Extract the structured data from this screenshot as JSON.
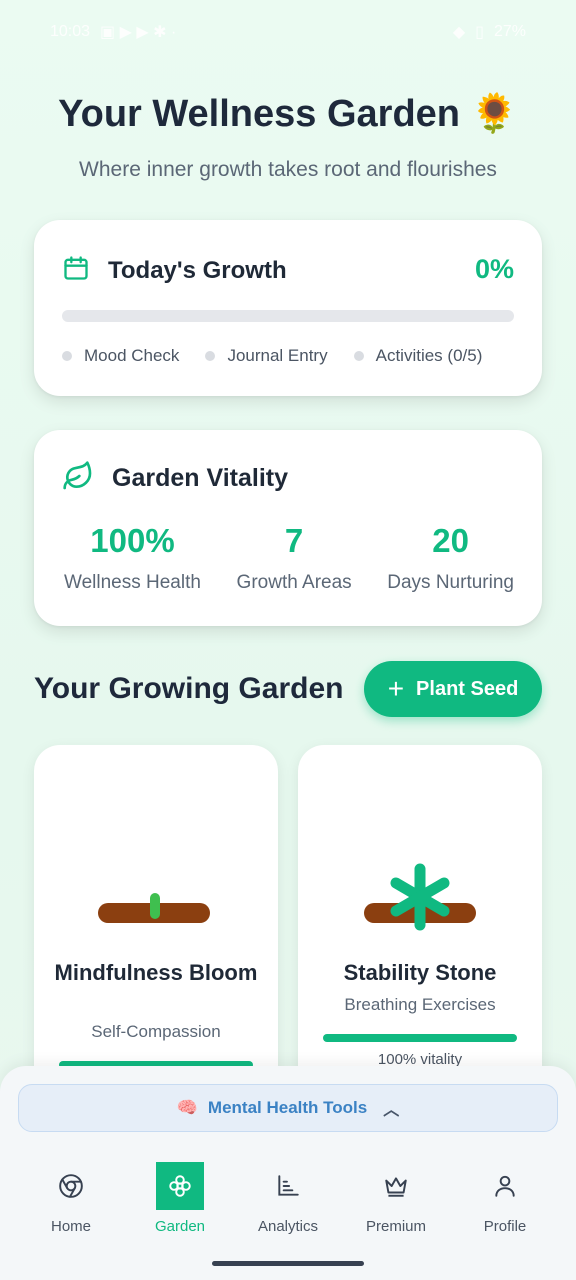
{
  "status_bar": {
    "time": "10:03",
    "battery": "27%"
  },
  "header": {
    "title": "Your Wellness Garden",
    "title_emoji": "🌻",
    "subtitle": "Where inner growth takes root and flourishes"
  },
  "todays_growth": {
    "title": "Today's Growth",
    "percent_label": "0%",
    "progress": 0,
    "items": [
      {
        "label": "Mood Check"
      },
      {
        "label": "Journal Entry"
      },
      {
        "label": "Activities (0/5)"
      }
    ]
  },
  "garden_vitality": {
    "title": "Garden Vitality",
    "stats": [
      {
        "value": "100%",
        "label": "Wellness Health"
      },
      {
        "value": "7",
        "label": "Growth Areas"
      },
      {
        "value": "20",
        "label": "Days Nurturing"
      }
    ]
  },
  "growing_garden": {
    "title": "Your Growing Garden",
    "plant_button_label": "Plant Seed",
    "plants": [
      {
        "name": "Mindfulness Bloom",
        "category": "Self-Compassion",
        "vitality_fraction": 1.0
      },
      {
        "name": "Stability Stone",
        "category": "Breathing Exercises",
        "vitality_fraction": 1.0,
        "vitality_label": "100% vitality"
      }
    ]
  },
  "tools_bar": {
    "emoji": "🧠",
    "label": "Mental Health Tools"
  },
  "nav": {
    "items": [
      {
        "label": "Home",
        "icon": "chrome-circle-icon",
        "active": false
      },
      {
        "label": "Garden",
        "icon": "flower-icon",
        "active": true
      },
      {
        "label": "Analytics",
        "icon": "chart-icon",
        "active": false
      },
      {
        "label": "Premium",
        "icon": "crown-icon",
        "active": false
      },
      {
        "label": "Profile",
        "icon": "user-icon",
        "active": false
      }
    ]
  },
  "colors": {
    "accent": "#10b981",
    "title": "#1e293b",
    "tools": "#3b82c4"
  }
}
